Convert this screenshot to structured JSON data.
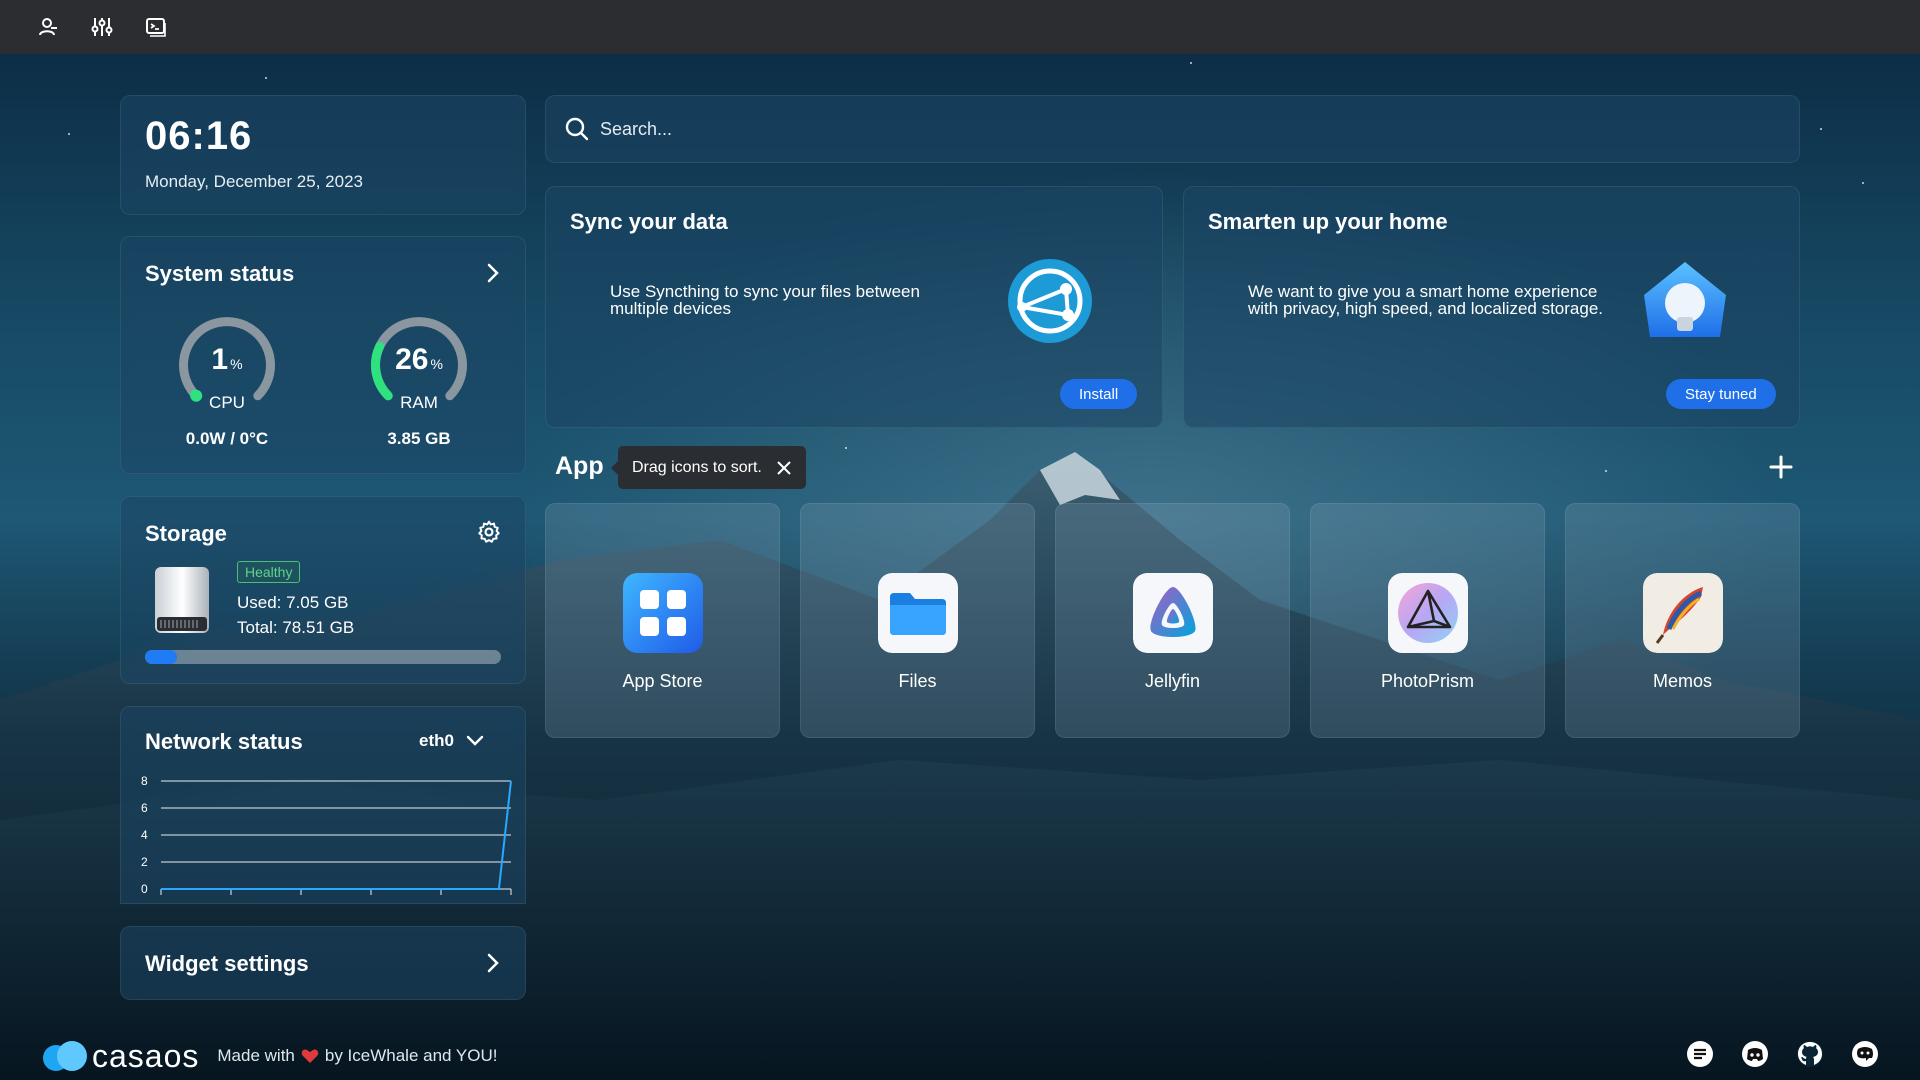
{
  "topbar": {
    "icons": [
      "account-icon",
      "sliders-icon",
      "terminal-icon"
    ]
  },
  "clock": {
    "time": "06:16",
    "date": "Monday, December 25, 2023"
  },
  "system_status": {
    "title": "System status",
    "cpu": {
      "value": "1",
      "unit": "%",
      "label": "CPU",
      "sub": "0.0W / 0°C",
      "fraction": 0.01
    },
    "ram": {
      "value": "26",
      "unit": "%",
      "label": "RAM",
      "sub": "3.85 GB",
      "fraction": 0.26
    }
  },
  "storage": {
    "title": "Storage",
    "badge": "Healthy",
    "used": "Used: 7.05 GB",
    "total": "Total: 78.51 GB",
    "usage_fraction": 0.09
  },
  "network": {
    "title": "Network status",
    "interface": "eth0",
    "chart_data": {
      "type": "line",
      "yticks": [
        "8",
        "6",
        "4",
        "2",
        "0"
      ],
      "ylim": [
        0,
        8
      ],
      "values": [
        0,
        0,
        0,
        0,
        0,
        0,
        0,
        0,
        0,
        0,
        0,
        0,
        0,
        0,
        0,
        0,
        0,
        0,
        0,
        0,
        0,
        0,
        0,
        0,
        0,
        0,
        0,
        0,
        0,
        8
      ]
    }
  },
  "widget_settings": {
    "title": "Widget settings"
  },
  "search": {
    "placeholder": "Search..."
  },
  "promos": [
    {
      "title": "Sync your data",
      "description": "Use Syncthing to sync your files between multiple devices",
      "button": "Install"
    },
    {
      "title": "Smarten up your home",
      "description": "We want to give you a smart home experience with privacy, high speed, and localized storage.",
      "button": "Stay tuned"
    }
  ],
  "apps": {
    "title": "App",
    "tooltip": "Drag icons to sort.",
    "items": [
      {
        "name": "App Store",
        "icon": "app-store-icon"
      },
      {
        "name": "Files",
        "icon": "folder-icon"
      },
      {
        "name": "Jellyfin",
        "icon": "jellyfin-icon"
      },
      {
        "name": "PhotoPrism",
        "icon": "photoprism-icon"
      },
      {
        "name": "Memos",
        "icon": "memos-icon"
      }
    ]
  },
  "footer": {
    "logo": "casaos",
    "made_prefix": "Made with",
    "made_suffix": "by IceWhale and YOU!",
    "social": [
      "feedback-icon",
      "discord-icon",
      "github-icon",
      "chat-icon"
    ]
  },
  "colors": {
    "accent": "#1f6fe8",
    "gauge_track": "#8a97a0",
    "gauge_fill": "#2ee27f",
    "healthy": "#5fd38a",
    "topbar": "#2b2d31"
  }
}
